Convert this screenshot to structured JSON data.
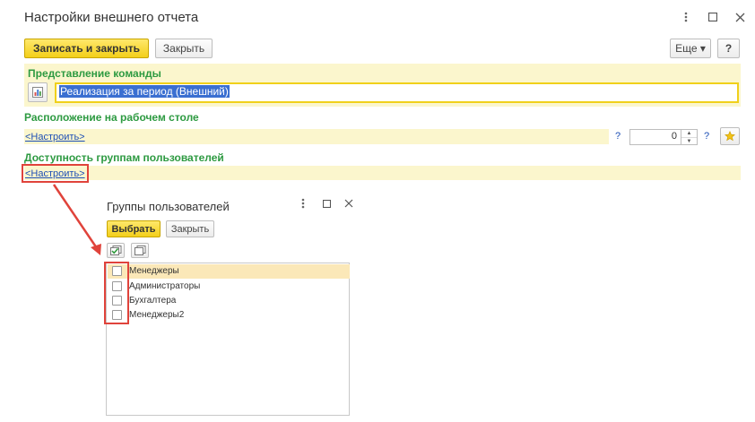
{
  "window": {
    "title": "Настройки внешнего отчета",
    "controls": [
      "more-icon",
      "maximize-icon",
      "close-icon"
    ]
  },
  "toolbar": {
    "save_close_label": "Записать и закрыть",
    "close_label": "Закрыть",
    "more_label": "Еще ▾",
    "help_label": "?"
  },
  "command_section": {
    "title": "Представление команды",
    "value": "Реализация за период (Внешний)",
    "icon": "report-icon"
  },
  "desktop_section": {
    "title": "Расположение на рабочем столе",
    "link": "<Настроить>",
    "order_value": "0",
    "help": "?",
    "star_icon": "star-icon"
  },
  "groups_section": {
    "title": "Доступность группам пользователей",
    "link": "<Настроить>"
  },
  "dialog": {
    "title": "Группы пользователей",
    "controls": [
      "more-icon",
      "maximize-icon",
      "close-icon"
    ],
    "select_label": "Выбрать",
    "close_label": "Закрыть",
    "check_all_icon": "check-all-icon",
    "uncheck_all_icon": "uncheck-all-icon",
    "items": [
      {
        "label": "Менеджеры",
        "checked": false,
        "selected": true
      },
      {
        "label": "Администраторы",
        "checked": false,
        "selected": false
      },
      {
        "label": "Бухгалтера",
        "checked": false,
        "selected": false
      },
      {
        "label": "Менеджеры2",
        "checked": false,
        "selected": false
      }
    ]
  },
  "colors": {
    "accent_yellow": "#f3cf1a",
    "section_green": "#2d9a41",
    "link_blue": "#1d4fb5",
    "highlight_red": "#e0433b",
    "band": "#fbf6cd"
  }
}
